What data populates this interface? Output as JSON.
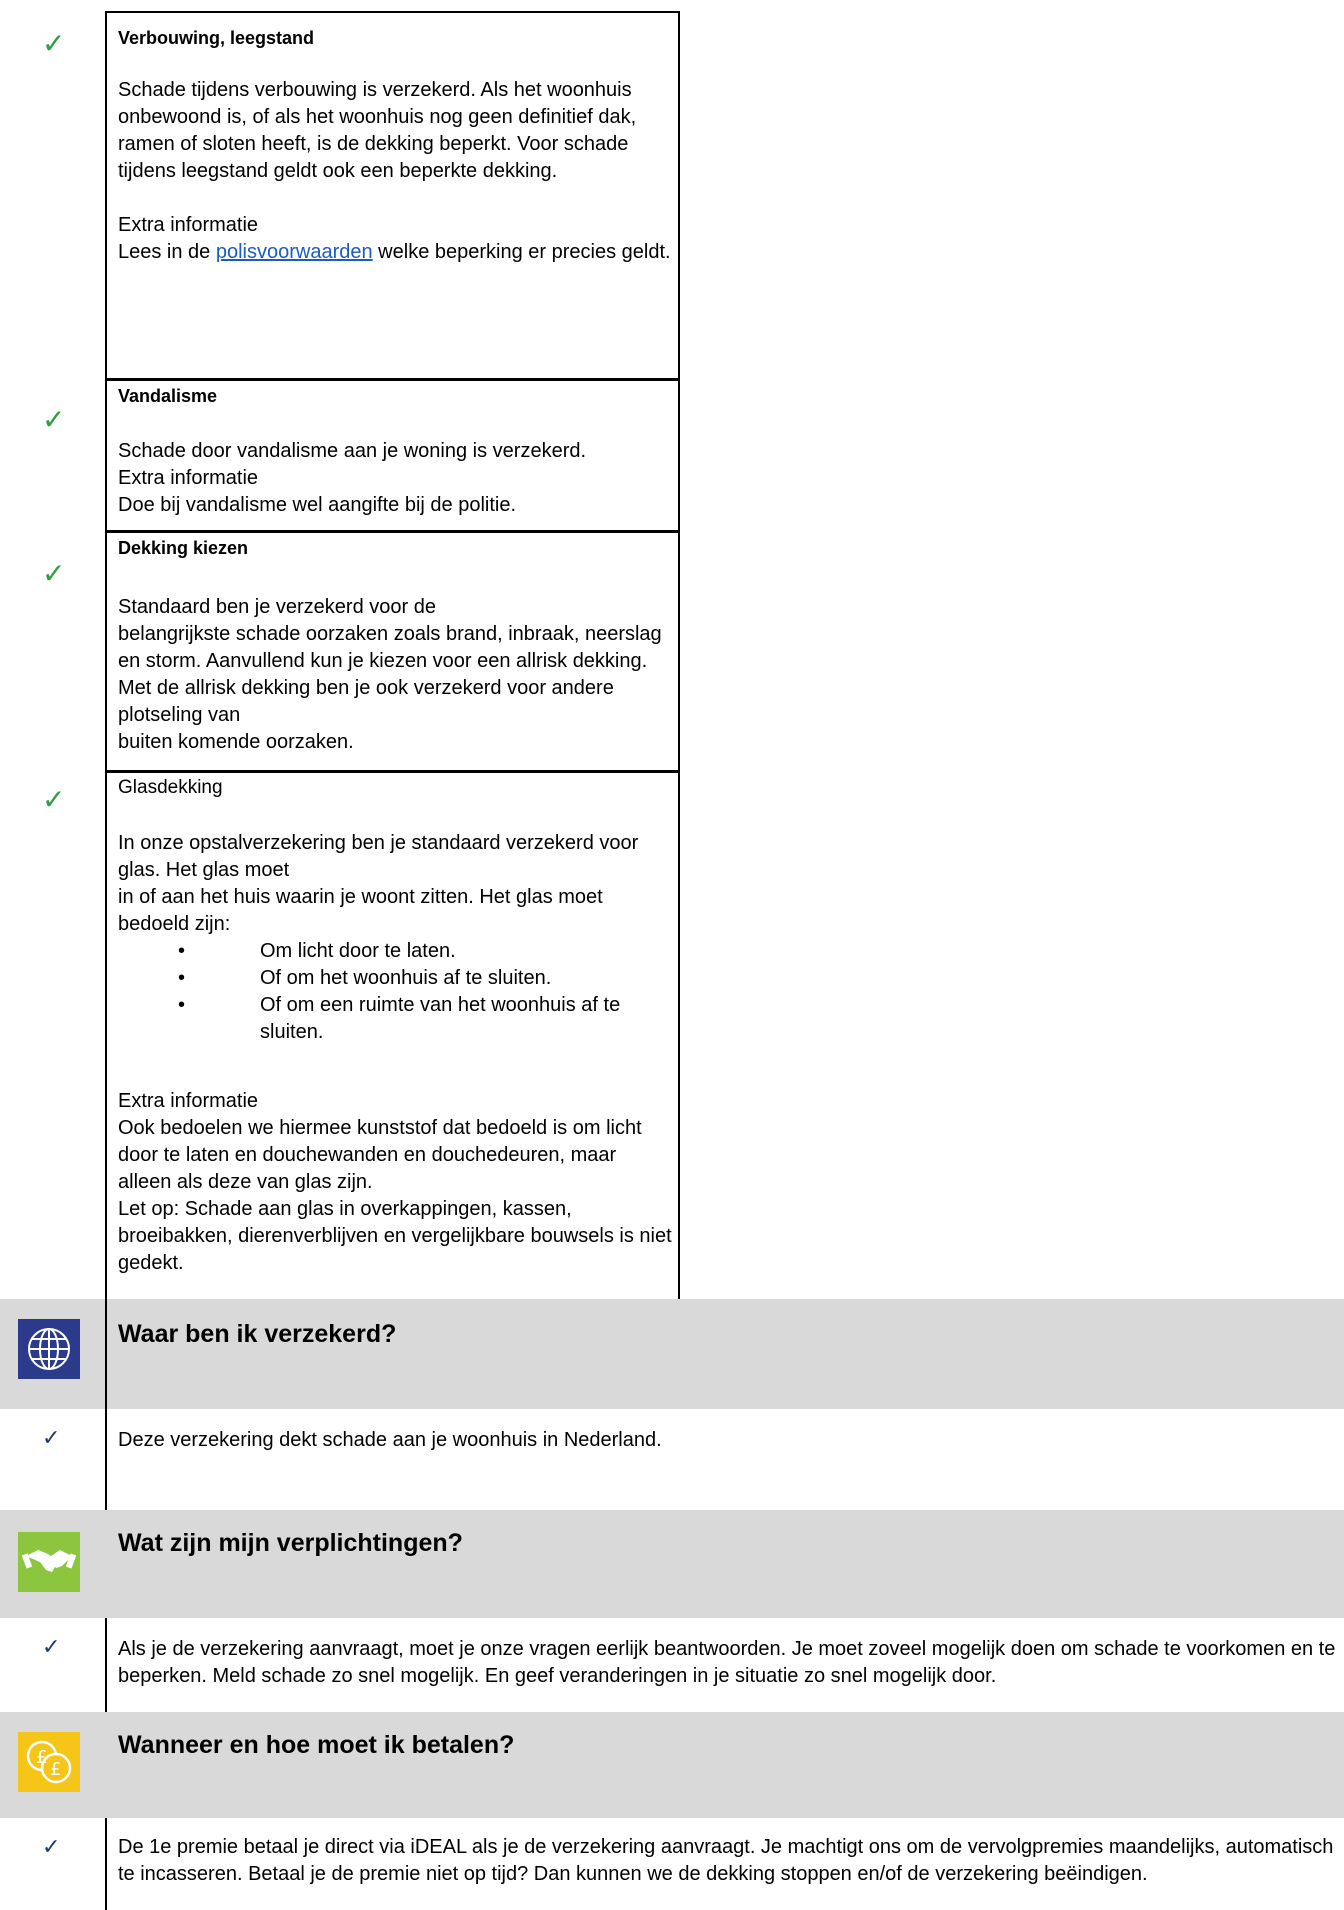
{
  "sections": {
    "verbouwing": {
      "title": "Verbouwing, leegstand",
      "body": "Schade tijdens verbouwing is verzekerd. Als het woonhuis onbewoond is, of als het woonhuis nog geen definitief dak, ramen of sloten heeft, is de dekking beperkt. Voor schade tijdens leegstand geldt ook een beperkte dekking.",
      "extra_label": "Extra informatie",
      "extra_prefix": "Lees in de ",
      "extra_link": "polisvoorwaarden",
      "extra_suffix": " welke beperking er precies geldt."
    },
    "vandalisme": {
      "title": "Vandalisme",
      "body": "Schade door vandalisme aan je woning is verzekerd.",
      "extra_label": "Extra informatie",
      "extra_text": "Doe bij vandalisme wel aangifte bij de politie."
    },
    "dekking": {
      "title": "Dekking kiezen",
      "line1": "Standaard ben je verzekerd voor de",
      "line2": "belangrijkste schade oorzaken zoals brand, inbraak, neerslag en storm. Aanvullend kun je kiezen voor een allrisk dekking. Met de allrisk dekking ben je ook verzekerd voor andere plotseling van",
      "line3": "buiten komende oorzaken."
    },
    "glas": {
      "title": "Glasdekking",
      "line1": "In onze opstalverzekering ben je standaard verzekerd voor glas. Het glas moet",
      "line2": "in of aan het huis waarin je woont zitten. Het glas moet bedoeld zijn:",
      "bullets": [
        "Om licht door te laten.",
        "Of om het woonhuis af te sluiten.",
        "Of om een ruimte van het woonhuis af te sluiten."
      ],
      "extra_label": "Extra informatie",
      "extra_text": "Ook bedoelen we hiermee kunststof dat bedoeld is om licht door te laten en douchewanden en douchedeuren, maar alleen als deze van glas zijn.",
      "note": "Let op: Schade aan glas in overkappingen, kassen, broeibakken, dierenverblijven en vergelijkbare bouwsels is niet gedekt."
    }
  },
  "bands": {
    "waar": {
      "title": "Waar ben ik verzekerd?",
      "icon": "globe-icon",
      "icon_bg": "#2b3a8a",
      "text": "Deze verzekering dekt schade aan je woonhuis in Nederland."
    },
    "verplichtingen": {
      "title": "Wat zijn mijn verplichtingen?",
      "icon": "handshake-icon",
      "icon_bg": "#8cc63f",
      "text": "Als je de verzekering aanvraagt, moet je onze vragen eerlijk beantwoorden. Je moet zoveel mogelijk doen om schade te voorkomen en te beperken. Meld schade zo snel mogelijk. En geef veranderingen in je situatie zo snel mogelijk door."
    },
    "betalen": {
      "title": "Wanneer en hoe moet ik betalen?",
      "icon": "pound-coins-icon",
      "icon_bg": "#f5c518",
      "text": "De 1e premie betaal je direct via iDEAL als je de verzekering aanvraagt. Je machtigt ons om de vervolgpremies maandelijks, automatisch te incasseren. Betaal je de premie niet op tijd? Dan kunnen we de dekking stoppen en/of de verzekering beëindigen."
    }
  },
  "check_symbol": "✓",
  "bullet_symbol": "•"
}
